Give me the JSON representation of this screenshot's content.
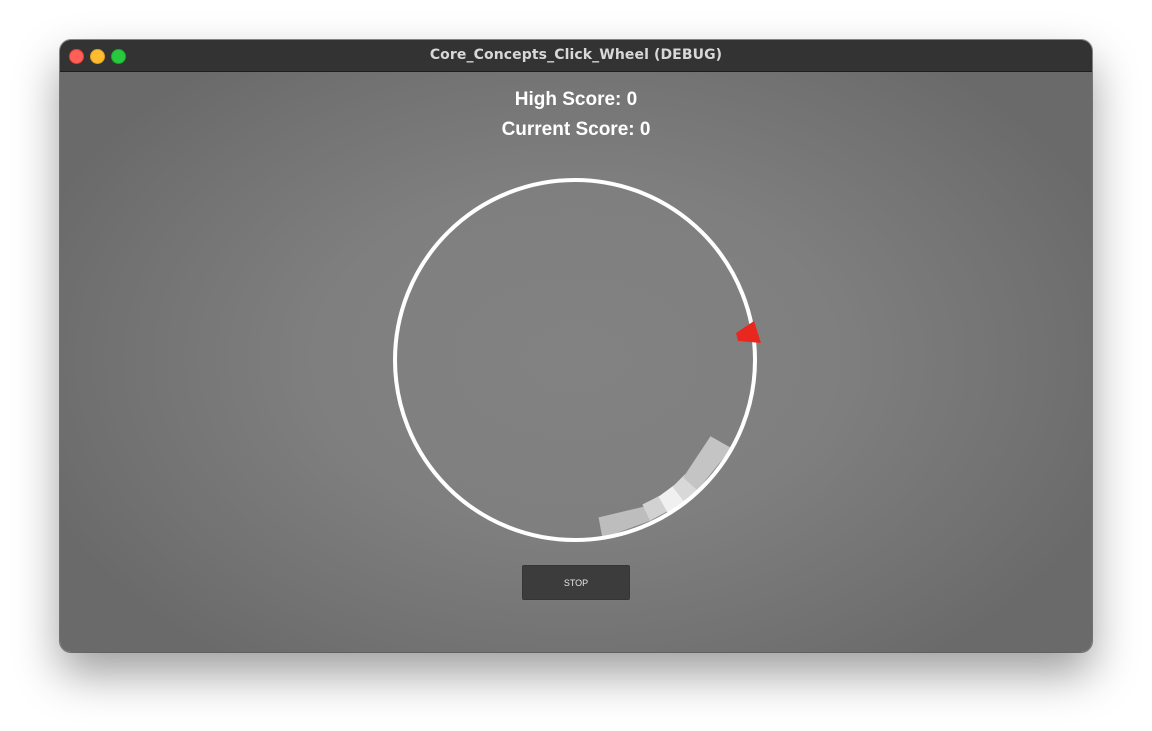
{
  "window": {
    "title": "Core_Concepts_Click_Wheel (DEBUG)"
  },
  "titlebar": {
    "buttons": [
      "close",
      "minimize",
      "zoom"
    ]
  },
  "scores": {
    "high": "High Score: 0",
    "current": "Current Score: 0"
  },
  "wheel": {
    "ring_color": "#ffffff",
    "pointer_color": "#e8281e",
    "target_zone_colors": [
      "#bdbdbd",
      "#d2d2d2",
      "#f0f0f0",
      "#d8d8d8",
      "#c4c4c4"
    ]
  },
  "controls": {
    "stop_label": "STOP"
  }
}
